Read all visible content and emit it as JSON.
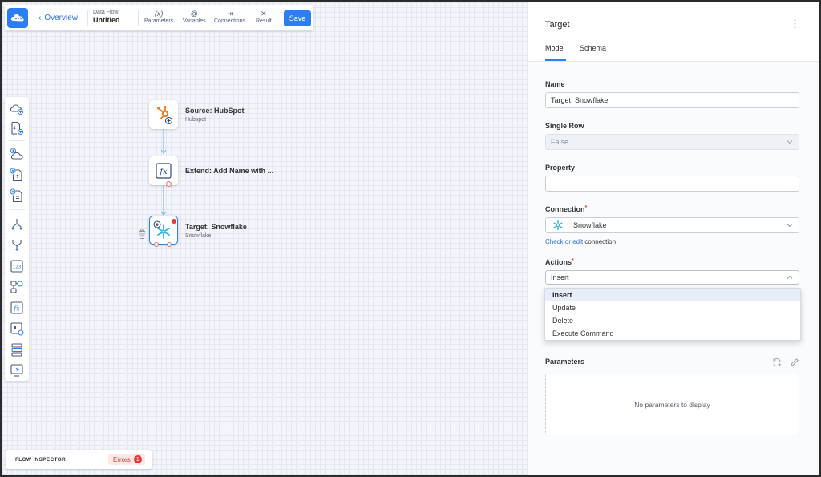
{
  "toolbar": {
    "back_label": "Overview",
    "flow_type": "Data Flow",
    "flow_name": "Untitled",
    "buttons": {
      "parameters": {
        "icon": "(x)",
        "label": "Parameters"
      },
      "variables": {
        "icon": "@",
        "label": "Variables"
      },
      "connections": {
        "icon": "⇥",
        "label": "Connections"
      },
      "result": {
        "icon": "✕",
        "label": "Result"
      }
    },
    "save_label": "Save"
  },
  "nodes": {
    "source": {
      "title": "Source: HubSpot",
      "subtitle": "Hubspot"
    },
    "extend": {
      "title": "Extend: Add Name with ..."
    },
    "target": {
      "title": "Target: Snowflake",
      "subtitle": "Snowflake"
    }
  },
  "inspector": {
    "label": "FLOW INSPECTOR",
    "errors_label": "Errors",
    "errors_count": "1"
  },
  "panel": {
    "title": "Target",
    "tabs": [
      {
        "label": "Model",
        "active": true
      },
      {
        "label": "Schema",
        "active": false
      }
    ],
    "name": {
      "label": "Name",
      "value": "Target: Snowflake"
    },
    "single_row": {
      "label": "Single Row",
      "value": "False"
    },
    "property": {
      "label": "Property",
      "value": ""
    },
    "connection": {
      "label": "Connection",
      "required": "*",
      "value": "Snowflake"
    },
    "helper": {
      "link": "Check or edit",
      "text": " connection"
    },
    "actions": {
      "label": "Actions",
      "required": "*",
      "value": "Insert",
      "options": [
        "Insert",
        "Update",
        "Delete",
        "Execute Command"
      ]
    },
    "parameters": {
      "label": "Parameters",
      "empty_text": "No parameters to display"
    }
  },
  "colors": {
    "accent": "#2c7ef4",
    "error": "#e53935",
    "hubspot": "#f57722",
    "snowflake": "#29b5e8"
  }
}
